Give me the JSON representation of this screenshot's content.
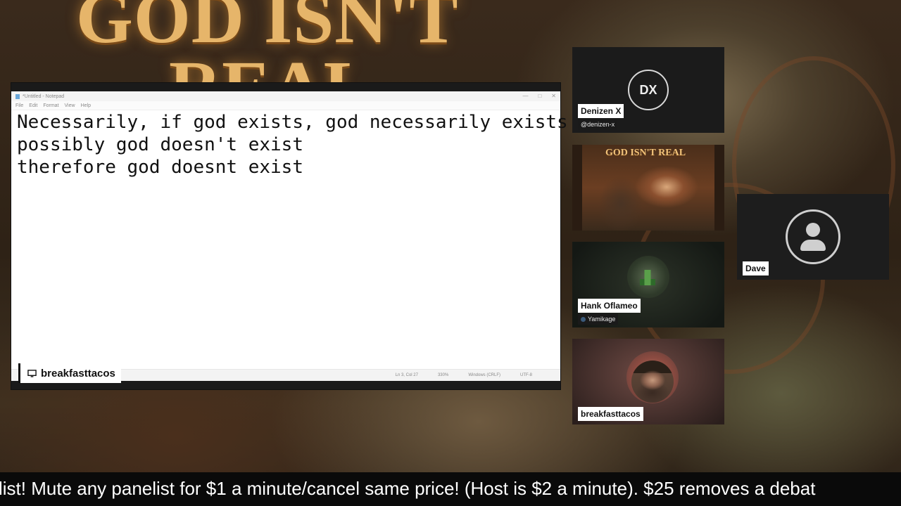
{
  "background": {
    "title_line1": "GOD ISN'T",
    "title_line2": "REAL"
  },
  "notepad": {
    "window_title": "*Untitled - Notepad",
    "menu": [
      "File",
      "Edit",
      "Format",
      "View",
      "Help"
    ],
    "lines": [
      "Necessarily, if god exists, god necessarily exists",
      "possibly god doesn't exist",
      "therefore god doesnt exist"
    ],
    "status": {
      "position": "Ln 3, Col 27",
      "zoom": "330%",
      "line_ending": "Windows (CRLF)",
      "encoding": "UTF-8"
    }
  },
  "screen_share": {
    "owner": "breakfasttacos",
    "icon": "monitor-icon"
  },
  "participants": {
    "denizen": {
      "initials": "DX",
      "name": "Denizen X",
      "handle": "@denizen-x"
    },
    "art_tile": {
      "title": "GOD ISN'T REAL"
    },
    "dave": {
      "name": "Dave",
      "icon": "user-icon"
    },
    "hank": {
      "name": "Hank Oflameo",
      "handle": "Yamikage"
    },
    "breakfast": {
      "name": "breakfasttacos"
    }
  },
  "ticker": {
    "text": "list! Mute any panelist for $1 a minute/cancel same price! (Host is $2 a minute). $25 removes a debat"
  },
  "colors": {
    "title_gold": "#e6b56a",
    "ticker_bg": "#0a0a0a",
    "label_bg": "#ffffff"
  }
}
